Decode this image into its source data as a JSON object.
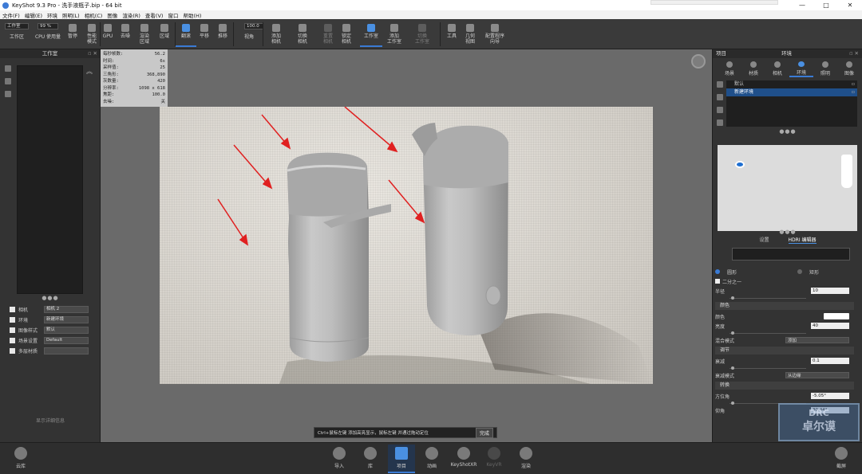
{
  "window": {
    "title": "KeyShot 9.3 Pro  - 洗手液瓶子.bip  - 64 bit",
    "controls": [
      "—",
      "□",
      "✕"
    ]
  },
  "menu": [
    "文件(F)",
    "编辑(E)",
    "环境",
    "照明(L)",
    "相机(C)",
    "图像",
    "渲染(R)",
    "查看(V)",
    "窗口",
    "帮助(H)"
  ],
  "toolbar": {
    "workspace_select": "工作室",
    "cpu_value": "99 %",
    "scene_value": "100.0",
    "buttons": [
      {
        "label": "工作区",
        "icon": "workspace-icon"
      },
      {
        "label": "CPU 使用量",
        "icon": "cpu-icon"
      },
      {
        "label": "暂停",
        "icon": "pause-icon"
      },
      {
        "label": "性能\n模式",
        "icon": "performance-icon"
      },
      {
        "label": "GPU",
        "icon": "gpu-icon"
      },
      {
        "label": "去噪",
        "icon": "denoise-icon"
      },
      {
        "label": "渲染\n区域",
        "icon": "region-icon"
      },
      {
        "label": "区域",
        "icon": "area-icon"
      },
      {
        "label": "翻滚",
        "icon": "tumble-icon"
      },
      {
        "label": "平移",
        "icon": "pan-icon"
      },
      {
        "label": "推移",
        "icon": "dolly-icon"
      },
      {
        "label": "视角",
        "icon": "fov-icon"
      },
      {
        "label": "添加\n相机",
        "icon": "add-camera-icon"
      },
      {
        "label": "切换\n相机",
        "icon": "switch-camera-icon"
      },
      {
        "label": "重置\n相机",
        "icon": "reset-camera-icon"
      },
      {
        "label": "锁定\n相机",
        "icon": "lock-camera-icon"
      },
      {
        "label": "工作室",
        "icon": "studio-icon"
      },
      {
        "label": "添加\n工作室",
        "icon": "add-studio-icon"
      },
      {
        "label": "切换\n工作室",
        "icon": "switch-studio-icon"
      },
      {
        "label": "工具",
        "icon": "tools-icon"
      },
      {
        "label": "几何\n视图",
        "icon": "geometry-view-icon"
      },
      {
        "label": "配置程序\n向导",
        "icon": "configurator-icon"
      }
    ]
  },
  "left_panel": {
    "title": "工作室",
    "rows": [
      {
        "label": "相机",
        "value": "相机 2"
      },
      {
        "label": "环境",
        "value": "新建环境"
      },
      {
        "label": "图像样式",
        "value": "默认"
      },
      {
        "label": "场景设置",
        "value": "Default"
      },
      {
        "label": "多层材质",
        "value": ""
      }
    ],
    "empty_hint": "显示详细信息"
  },
  "stats": [
    {
      "k": "每秒帧数:",
      "v": "56.2"
    },
    {
      "k": "时间:",
      "v": "6s"
    },
    {
      "k": "采样值:",
      "v": "25"
    },
    {
      "k": "三角形:",
      "v": "368,890"
    },
    {
      "k": "灰数量:",
      "v": "420"
    },
    {
      "k": "分辨率:",
      "v": "1098 x 618"
    },
    {
      "k": "焦距:",
      "v": "100.0"
    },
    {
      "k": "去噪:",
      "v": "关"
    }
  ],
  "hint": {
    "text": "Ctrl+鼠标左键 添加高亮显示，鼠标左键 并通过拖动定位",
    "done": "完成"
  },
  "right_panel": {
    "title_left": "项目",
    "title_center": "环境",
    "tabs": [
      "场景",
      "材质",
      "相机",
      "环境",
      "照明",
      "图像"
    ],
    "env_items": [
      "默认",
      "新建环境"
    ],
    "subtabs": [
      "设置",
      "HDRI 编辑器"
    ],
    "shape_options": [
      "圆形",
      "矩形"
    ],
    "half_label": "二分之一",
    "radius_label": "半径",
    "radius_value": "10",
    "section_color": "颜色",
    "color_label": "颜色",
    "brightness_label": "亮度",
    "brightness_value": "40",
    "blend_label": "混合模式",
    "blend_value": "添加",
    "section_adjust": "调节",
    "falloff_label": "衰减",
    "falloff_value": "0.1",
    "falloff_mode_label": "衰减模式",
    "falloff_mode_value": "从边缘",
    "section_transform": "转换",
    "azimuth_label": "方位角",
    "azimuth_value": "-5.05°",
    "height_label": "仰角",
    "height_value": "30.44°",
    "watermark_1": "DRC",
    "watermark_2": "卓尔谟"
  },
  "dock": {
    "left": {
      "label": "云库"
    },
    "items": [
      {
        "label": "导入"
      },
      {
        "label": "库"
      },
      {
        "label": "项目"
      },
      {
        "label": "动画"
      },
      {
        "label": "KeyShotXR"
      },
      {
        "label": "KeyVR"
      },
      {
        "label": "渲染"
      }
    ],
    "right": {
      "label": "截屏"
    }
  },
  "colors": {
    "accent": "#3a7bd5",
    "arrow": "#e02020",
    "bottle": "#b9b9b9"
  }
}
